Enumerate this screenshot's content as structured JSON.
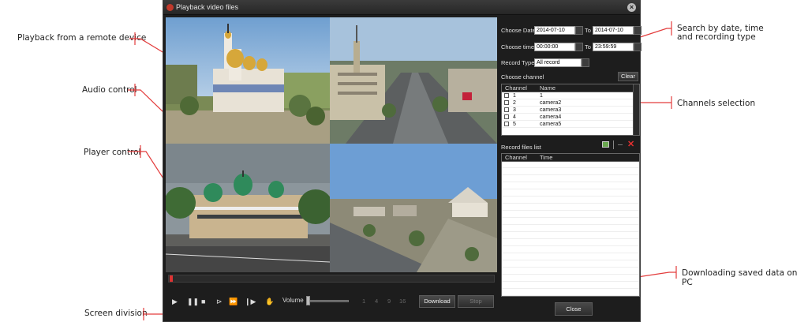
{
  "annotations": {
    "playback_remote": "Playback from a remote device",
    "audio_control": "Audio control",
    "player_control": "Player control",
    "screen_division": "Screen division",
    "search_line1": "Search by date, time",
    "search_line2": "and recording type",
    "channels_selection": "Channels selection",
    "downloading": "Downloading saved data on PC"
  },
  "window": {
    "title": "Playback video files",
    "close_glyph": "×"
  },
  "search": {
    "choose_date_label": "Choose Date",
    "date_from": "2014-07-10",
    "to_label": "To",
    "date_to": "2014-07-10",
    "choose_time_label": "Choose time",
    "time_from": "00:00:00",
    "time_to": "23:59:59",
    "record_type_label": "Record Type",
    "record_type_value": "All record"
  },
  "channels": {
    "title": "Choose channel",
    "clear_label": "Clear",
    "header_channel": "Channel",
    "header_name": "Name",
    "rows": [
      {
        "num": "1",
        "name": "1"
      },
      {
        "num": "2",
        "name": "camera2"
      },
      {
        "num": "3",
        "name": "camera3"
      },
      {
        "num": "4",
        "name": "camera4"
      },
      {
        "num": "5",
        "name": "camera5"
      }
    ]
  },
  "record_list": {
    "title": "Record files list",
    "header_channel": "Channel",
    "header_time": "Time"
  },
  "controls": {
    "volume_label": "Volume",
    "screen_divisions": [
      "1",
      "4",
      "9",
      "16"
    ],
    "download_label": "Download",
    "stop_label": "Stop",
    "close_label": "Close"
  },
  "colors": {
    "window_bg": "#1d1d1d",
    "progress_knob": "#dd3333",
    "annotation_line": "#e33c3c"
  }
}
